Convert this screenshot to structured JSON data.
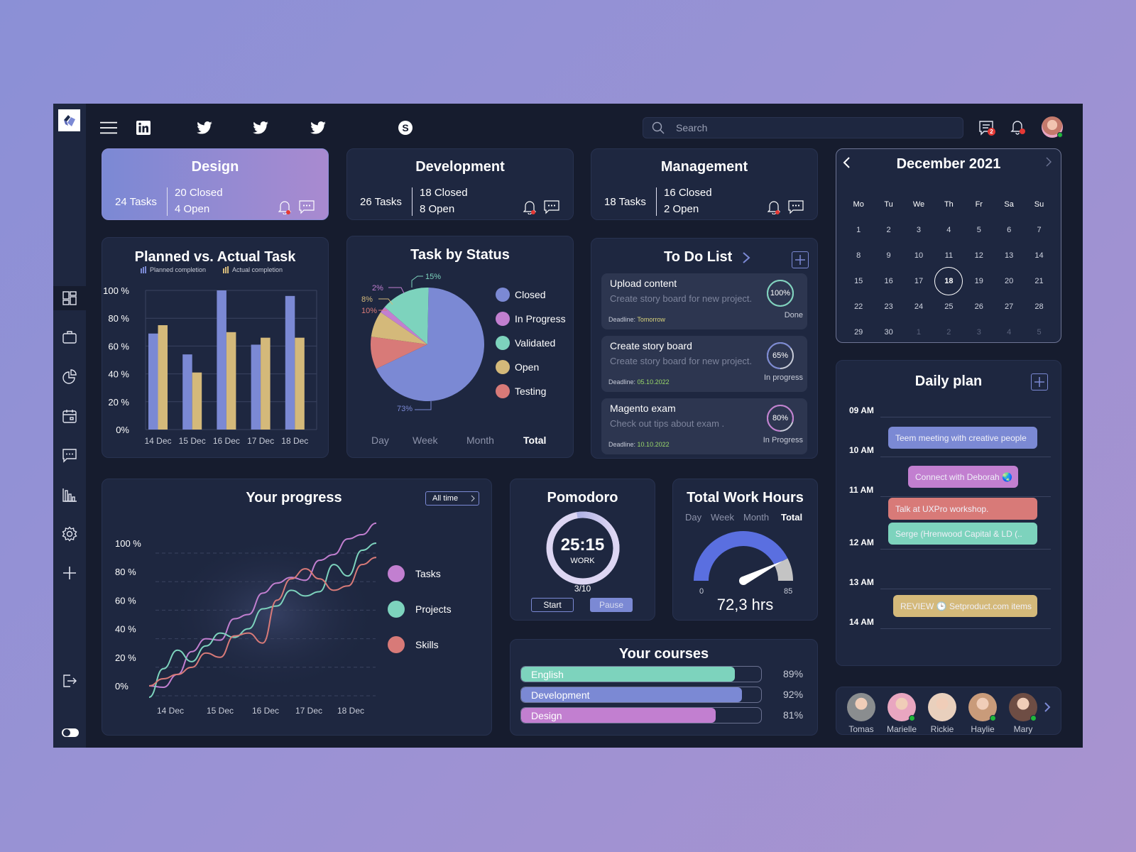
{
  "topbar": {
    "social_icons": [
      "linkedin-icon",
      "twitter-icon",
      "twitter-icon",
      "twitter-icon",
      "skype-icon"
    ],
    "search_placeholder": "Search",
    "messages_badge": "2"
  },
  "sidebar": {
    "items": [
      "dashboard",
      "portfolio",
      "pie-chart",
      "calendar",
      "chat",
      "statistics",
      "settings",
      "add"
    ],
    "active": "dashboard"
  },
  "categories": [
    {
      "title": "Design",
      "tasks": "24 Tasks",
      "closed": "20 Closed",
      "open": "4 Open",
      "active": true
    },
    {
      "title": "Development",
      "tasks": "26 Tasks",
      "closed": "18 Closed",
      "open": "8 Open",
      "active": false
    },
    {
      "title": "Management",
      "tasks": "18 Tasks",
      "closed": "16 Closed",
      "open": "2 Open",
      "active": false
    }
  ],
  "planned_actual": {
    "title": "Planned vs.  Actual Task",
    "legend_planned": "Planned completion",
    "legend_actual": "Actual completion"
  },
  "task_status": {
    "title": "Task by Status",
    "tabs": [
      "Day",
      "Week",
      "Month",
      "Total"
    ],
    "active_tab": "Total"
  },
  "todo": {
    "title": "To Do List",
    "items": [
      {
        "title": "Upload content",
        "desc": "Create story board for new project.",
        "deadline_label": "Deadline:",
        "deadline": "Tomorrow",
        "percent": "100%",
        "value": 100,
        "status": "Done",
        "ring_color": "#7dd3bd",
        "deadline_color": "#d8d27a"
      },
      {
        "title": "Create story board",
        "desc": "Create story board for new project.",
        "deadline_label": "Deadline:",
        "deadline": "05.10.2022",
        "percent": "65%",
        "value": 65,
        "status": "In progress",
        "ring_color": "#7b89d4",
        "deadline_color": "#9ad86a"
      },
      {
        "title": "Magento exam",
        "desc": "Check out tips about exam .",
        "deadline_label": "Deadline:",
        "deadline": "10.10.2022",
        "percent": "80%",
        "value": 80,
        "status": "In Progress",
        "ring_color": "#c27fd0",
        "deadline_color": "#9ad86a"
      }
    ]
  },
  "calendar": {
    "title": "December 2021",
    "weekdays": [
      "Mo",
      "Tu",
      "We",
      "Th",
      "Fr",
      "Sa",
      "Su"
    ],
    "weeks": [
      [
        "1",
        "2",
        "3",
        "4",
        "5",
        "6",
        "7"
      ],
      [
        "8",
        "9",
        "10",
        "11",
        "12",
        "13",
        "14"
      ],
      [
        "15",
        "16",
        "17",
        "18",
        "19",
        "20",
        "21"
      ],
      [
        "22",
        "23",
        "24",
        "25",
        "26",
        "27",
        "28"
      ],
      [
        "29",
        "30",
        "1",
        "2",
        "3",
        "4",
        "5"
      ]
    ],
    "selected": "18"
  },
  "daily_plan": {
    "title": "Daily plan",
    "times": [
      "09 AM",
      "10 AM",
      "11  AM",
      "12 AM",
      "13 AM",
      "14 AM"
    ],
    "events": [
      {
        "label": "Teem meeting with creative people",
        "color": "#7b89d4"
      },
      {
        "label": "Connect with Deborah 🌏",
        "color": "#c27fd0"
      },
      {
        "label": "Talk at UXPro workshop.",
        "color": "#d87a78"
      },
      {
        "label": "Serge (Hrenwood Capital & LD (..",
        "color": "#7dd3bd"
      },
      {
        "label": "REVIEW 🕒 Setproduct.com items",
        "color": "#d4b97a"
      }
    ]
  },
  "progress": {
    "title": "Your progress",
    "filter": "All time"
  },
  "pomodoro": {
    "title": "Pomodoro",
    "time": "25:15",
    "mode": "WORK",
    "count": "3/10",
    "progress": 0.3,
    "start": "Start",
    "pause": "Pause"
  },
  "work_hours": {
    "title": "Total Work Hours",
    "tabs": [
      "Day",
      "Week",
      "Month",
      "Total"
    ],
    "active_tab": "Total",
    "min": "0",
    "max": "85",
    "value_num": 72.3,
    "max_num": 85,
    "value": "72,3 hrs"
  },
  "courses": {
    "title": "Your courses",
    "items": [
      {
        "name": "English",
        "percent": "89%",
        "value": 89,
        "color": "#7dd3bd"
      },
      {
        "name": "Development",
        "percent": "92%",
        "value": 92,
        "color": "#7b89d4"
      },
      {
        "name": "Design",
        "percent": "81%",
        "value": 81,
        "color": "#c27fd0"
      }
    ]
  },
  "team": {
    "members": [
      {
        "name": "Tomas",
        "online": false,
        "color": "#8a8d8f"
      },
      {
        "name": "Marielle",
        "online": true,
        "color": "#e9a6c0"
      },
      {
        "name": "Rickie",
        "online": false,
        "color": "#e9d0bd"
      },
      {
        "name": "Haylie",
        "online": true,
        "color": "#c99b7a"
      },
      {
        "name": "Mary",
        "online": true,
        "color": "#6e4d44"
      }
    ]
  },
  "chart_data": [
    {
      "type": "bar",
      "title": "Planned vs.  Actual Task",
      "categories": [
        "14 Dec",
        "15 Dec",
        "16 Dec",
        "17 Dec",
        "18 Dec"
      ],
      "series": [
        {
          "name": "Planned completion",
          "color": "#7b89d4",
          "values": [
            69,
            54,
            100,
            61,
            96
          ]
        },
        {
          "name": "Actual completion",
          "color": "#d4b97a",
          "values": [
            75,
            41,
            70,
            66,
            66
          ]
        }
      ],
      "yticks": [
        "0%",
        "20 %",
        "40 %",
        "60 %",
        "80 %",
        "100 %"
      ],
      "ylim": [
        0,
        100
      ],
      "grid": true,
      "legend": "top"
    },
    {
      "type": "pie",
      "title": "Task by Status",
      "slices": [
        {
          "label": "Closed",
          "value": 73,
          "display": "73%",
          "color": "#7b89d4"
        },
        {
          "label": "Testing",
          "value": 10,
          "display": "10%",
          "color": "#d87a78"
        },
        {
          "label": "Open",
          "value": 8,
          "display": "8%",
          "color": "#d4b97a"
        },
        {
          "label": "In Progress",
          "value": 2,
          "display": "2%",
          "color": "#c27fd0"
        },
        {
          "label": "Validated",
          "value": 15,
          "display": "15%",
          "color": "#7dd3bd"
        }
      ],
      "legend_order": [
        "Closed",
        "In Progress",
        "Validated",
        "Open",
        "Testing"
      ],
      "legend": "right"
    },
    {
      "type": "line",
      "title": "Your progress",
      "x": [
        "14 Dec",
        "15 Dec",
        "16 Dec",
        "17 Dec",
        "18 Dec"
      ],
      "yticks": [
        "0%",
        "20 %",
        "40 %",
        "60 %",
        "80 %",
        "100 %"
      ],
      "ylim": [
        -5,
        120
      ],
      "series": [
        {
          "name": "Tasks",
          "color": "#c27fd0",
          "values": [
            0,
            -1,
            8,
            24,
            33,
            32,
            47,
            50,
            65,
            72,
            76,
            74,
            88,
            92,
            103,
            106,
            114
          ]
        },
        {
          "name": "Projects",
          "color": "#7dd3bd",
          "values": [
            -8,
            12,
            25,
            17,
            28,
            37,
            34,
            40,
            54,
            56,
            67,
            63,
            66,
            85,
            77,
            95,
            100
          ]
        },
        {
          "name": "Skills",
          "color": "#d87a78",
          "values": [
            0,
            5,
            8,
            13,
            23,
            20,
            35,
            37,
            30,
            60,
            75,
            82,
            75,
            67,
            70,
            85,
            90
          ]
        }
      ],
      "legend": "right",
      "grid": true
    },
    {
      "type": "bar",
      "title": "Your courses",
      "orientation": "horizontal",
      "categories": [
        "English",
        "Development",
        "Design"
      ],
      "values": [
        89,
        92,
        81
      ],
      "xlim": [
        0,
        100
      ]
    }
  ]
}
